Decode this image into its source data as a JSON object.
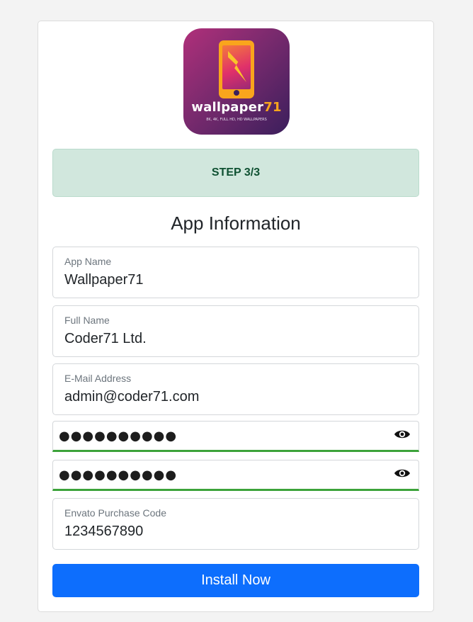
{
  "logo": {
    "word": "wallpaper",
    "word_number": "71",
    "tagline": "8K, 4K, FULL HD, HD WALLPAPERS",
    "icon": "phone-icon"
  },
  "step": {
    "label": "STEP 3/3"
  },
  "form": {
    "title": "App Information",
    "app_name": {
      "label": "App Name",
      "value": "Wallpaper71"
    },
    "full_name": {
      "label": "Full Name",
      "value": "Coder71 Ltd."
    },
    "email": {
      "label": "E-Mail Address",
      "value": "admin@coder71.com"
    },
    "password": {
      "masked": "●●●●●●●●●●",
      "icon": "eye-icon"
    },
    "password_confirm": {
      "masked": "●●●●●●●●●●",
      "icon": "eye-icon"
    },
    "purchase_code": {
      "label": "Envato Purchase Code",
      "value": "1234567890"
    },
    "submit_label": "Install Now"
  },
  "colors": {
    "accent": "#0d6efd",
    "success_bg": "#d1e7dd",
    "success_text": "#0f5132",
    "valid_border": "#3ca33a"
  }
}
